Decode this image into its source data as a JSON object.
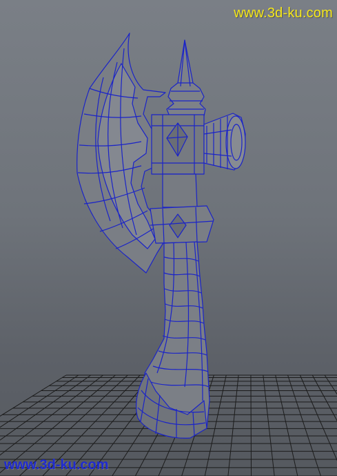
{
  "viewport": {
    "watermark_top": "www.3d-ku.com",
    "watermark_bottom": "www.3d-ku.com"
  },
  "colors": {
    "background": "#6e737a",
    "mesh_fill": "#7b7f86",
    "wireframe": "#1a23c8",
    "grid": "#1b1b1b",
    "watermark_top": "#f6e81a",
    "watermark_bottom": "#1f2bd0"
  },
  "icons": [
    "axe-model",
    "ground-grid"
  ]
}
